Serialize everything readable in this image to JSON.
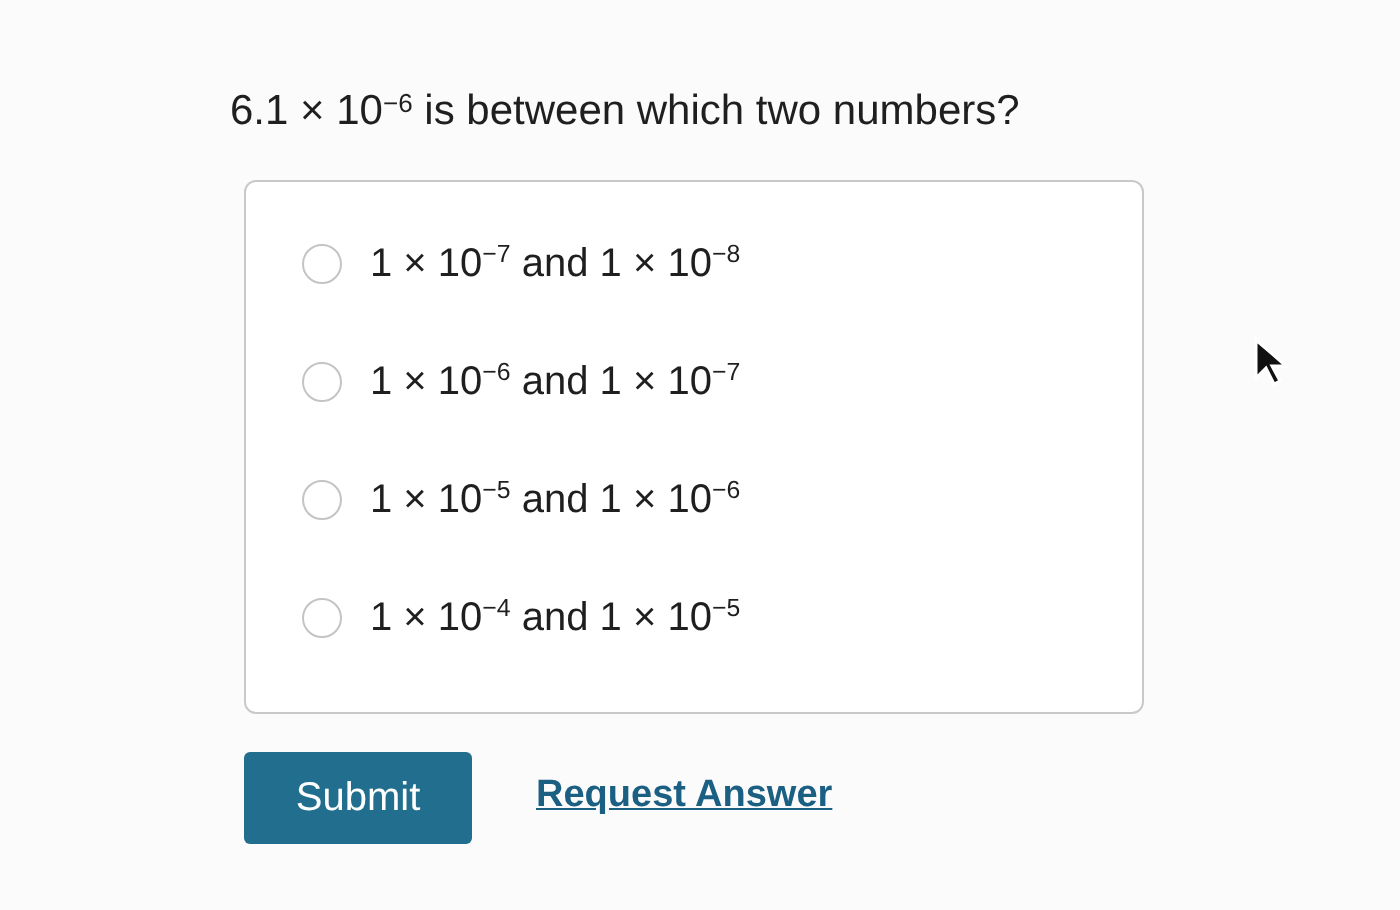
{
  "question": "6.1 × 10$^{−6}$ is between which two numbers?",
  "options": [
    {
      "label": "1 × 10$^{−7}$ and 1 × 10$^{−8}$",
      "selected": false
    },
    {
      "label": "1 × 10$^{−6}$ and 1 × 10$^{−7}$",
      "selected": false
    },
    {
      "label": "1 × 10$^{−5}$ and 1 × 10$^{−6}$",
      "selected": false
    },
    {
      "label": "1 × 10$^{−4}$ and 1 × 10$^{−5}$",
      "selected": false
    }
  ],
  "submit": "Submit",
  "request_link": "Request Answer"
}
